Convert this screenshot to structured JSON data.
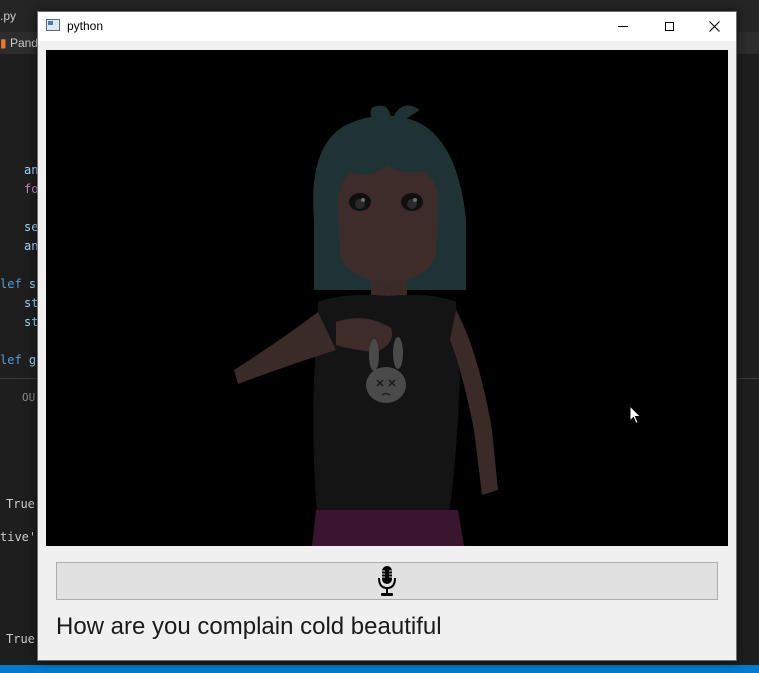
{
  "window": {
    "title": "python",
    "controls": {
      "minimize": "minimize",
      "maximize": "maximize",
      "close": "close"
    }
  },
  "avatar_view": {
    "description_icon": "avatar-video-icon"
  },
  "mic_button": {
    "icon": "microphone-icon"
  },
  "transcript": {
    "text": "How are you complain cold beautiful"
  },
  "background_editor": {
    "tab_label": "Pand",
    "file_label": ".py",
    "code_lines": [
      {
        "kw": "",
        "text": "an"
      },
      {
        "kw": "fo",
        "text": ""
      },
      {
        "kw": "",
        "text": "se"
      },
      {
        "kw": "",
        "text": "an"
      },
      {
        "kw": "lef",
        "text": "st"
      },
      {
        "kw": "",
        "text": "st"
      },
      {
        "kw": "",
        "text": "st"
      },
      {
        "kw": "lef",
        "text": "ge"
      }
    ],
    "panel_tab": "OU",
    "output_lines": [
      "True",
      "tive'",
      "True"
    ]
  },
  "colors": {
    "window_bg": "#f0f0f0",
    "video_bg": "#000000",
    "editor_bg": "#1e1e1e",
    "statusbar": "#007acc"
  }
}
